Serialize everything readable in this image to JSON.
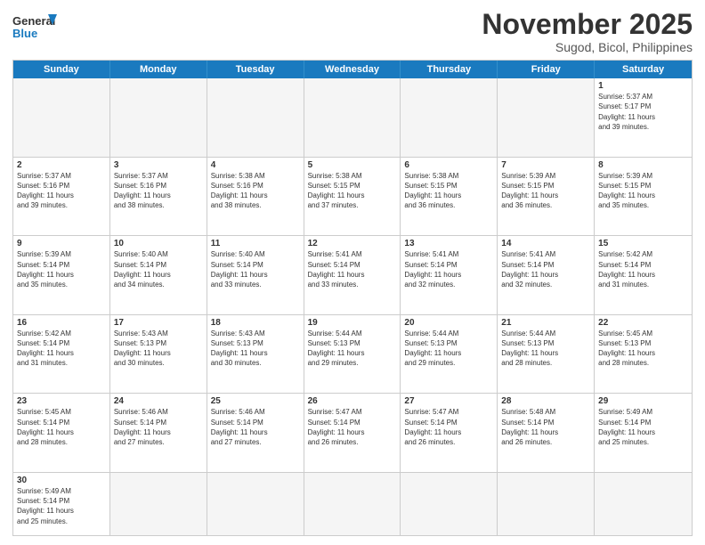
{
  "header": {
    "logo_general": "General",
    "logo_blue": "Blue",
    "month": "November 2025",
    "location": "Sugod, Bicol, Philippines"
  },
  "weekdays": [
    "Sunday",
    "Monday",
    "Tuesday",
    "Wednesday",
    "Thursday",
    "Friday",
    "Saturday"
  ],
  "rows": [
    [
      {
        "day": "",
        "info": ""
      },
      {
        "day": "",
        "info": ""
      },
      {
        "day": "",
        "info": ""
      },
      {
        "day": "",
        "info": ""
      },
      {
        "day": "",
        "info": ""
      },
      {
        "day": "",
        "info": ""
      },
      {
        "day": "1",
        "info": "Sunrise: 5:37 AM\nSunset: 5:17 PM\nDaylight: 11 hours\nand 39 minutes."
      }
    ],
    [
      {
        "day": "2",
        "info": "Sunrise: 5:37 AM\nSunset: 5:16 PM\nDaylight: 11 hours\nand 39 minutes."
      },
      {
        "day": "3",
        "info": "Sunrise: 5:37 AM\nSunset: 5:16 PM\nDaylight: 11 hours\nand 38 minutes."
      },
      {
        "day": "4",
        "info": "Sunrise: 5:38 AM\nSunset: 5:16 PM\nDaylight: 11 hours\nand 38 minutes."
      },
      {
        "day": "5",
        "info": "Sunrise: 5:38 AM\nSunset: 5:15 PM\nDaylight: 11 hours\nand 37 minutes."
      },
      {
        "day": "6",
        "info": "Sunrise: 5:38 AM\nSunset: 5:15 PM\nDaylight: 11 hours\nand 36 minutes."
      },
      {
        "day": "7",
        "info": "Sunrise: 5:39 AM\nSunset: 5:15 PM\nDaylight: 11 hours\nand 36 minutes."
      },
      {
        "day": "8",
        "info": "Sunrise: 5:39 AM\nSunset: 5:15 PM\nDaylight: 11 hours\nand 35 minutes."
      }
    ],
    [
      {
        "day": "9",
        "info": "Sunrise: 5:39 AM\nSunset: 5:14 PM\nDaylight: 11 hours\nand 35 minutes."
      },
      {
        "day": "10",
        "info": "Sunrise: 5:40 AM\nSunset: 5:14 PM\nDaylight: 11 hours\nand 34 minutes."
      },
      {
        "day": "11",
        "info": "Sunrise: 5:40 AM\nSunset: 5:14 PM\nDaylight: 11 hours\nand 33 minutes."
      },
      {
        "day": "12",
        "info": "Sunrise: 5:41 AM\nSunset: 5:14 PM\nDaylight: 11 hours\nand 33 minutes."
      },
      {
        "day": "13",
        "info": "Sunrise: 5:41 AM\nSunset: 5:14 PM\nDaylight: 11 hours\nand 32 minutes."
      },
      {
        "day": "14",
        "info": "Sunrise: 5:41 AM\nSunset: 5:14 PM\nDaylight: 11 hours\nand 32 minutes."
      },
      {
        "day": "15",
        "info": "Sunrise: 5:42 AM\nSunset: 5:14 PM\nDaylight: 11 hours\nand 31 minutes."
      }
    ],
    [
      {
        "day": "16",
        "info": "Sunrise: 5:42 AM\nSunset: 5:14 PM\nDaylight: 11 hours\nand 31 minutes."
      },
      {
        "day": "17",
        "info": "Sunrise: 5:43 AM\nSunset: 5:13 PM\nDaylight: 11 hours\nand 30 minutes."
      },
      {
        "day": "18",
        "info": "Sunrise: 5:43 AM\nSunset: 5:13 PM\nDaylight: 11 hours\nand 30 minutes."
      },
      {
        "day": "19",
        "info": "Sunrise: 5:44 AM\nSunset: 5:13 PM\nDaylight: 11 hours\nand 29 minutes."
      },
      {
        "day": "20",
        "info": "Sunrise: 5:44 AM\nSunset: 5:13 PM\nDaylight: 11 hours\nand 29 minutes."
      },
      {
        "day": "21",
        "info": "Sunrise: 5:44 AM\nSunset: 5:13 PM\nDaylight: 11 hours\nand 28 minutes."
      },
      {
        "day": "22",
        "info": "Sunrise: 5:45 AM\nSunset: 5:13 PM\nDaylight: 11 hours\nand 28 minutes."
      }
    ],
    [
      {
        "day": "23",
        "info": "Sunrise: 5:45 AM\nSunset: 5:14 PM\nDaylight: 11 hours\nand 28 minutes."
      },
      {
        "day": "24",
        "info": "Sunrise: 5:46 AM\nSunset: 5:14 PM\nDaylight: 11 hours\nand 27 minutes."
      },
      {
        "day": "25",
        "info": "Sunrise: 5:46 AM\nSunset: 5:14 PM\nDaylight: 11 hours\nand 27 minutes."
      },
      {
        "day": "26",
        "info": "Sunrise: 5:47 AM\nSunset: 5:14 PM\nDaylight: 11 hours\nand 26 minutes."
      },
      {
        "day": "27",
        "info": "Sunrise: 5:47 AM\nSunset: 5:14 PM\nDaylight: 11 hours\nand 26 minutes."
      },
      {
        "day": "28",
        "info": "Sunrise: 5:48 AM\nSunset: 5:14 PM\nDaylight: 11 hours\nand 26 minutes."
      },
      {
        "day": "29",
        "info": "Sunrise: 5:49 AM\nSunset: 5:14 PM\nDaylight: 11 hours\nand 25 minutes."
      }
    ],
    [
      {
        "day": "30",
        "info": "Sunrise: 5:49 AM\nSunset: 5:14 PM\nDaylight: 11 hours\nand 25 minutes."
      },
      {
        "day": "",
        "info": ""
      },
      {
        "day": "",
        "info": ""
      },
      {
        "day": "",
        "info": ""
      },
      {
        "day": "",
        "info": ""
      },
      {
        "day": "",
        "info": ""
      },
      {
        "day": "",
        "info": ""
      }
    ]
  ]
}
